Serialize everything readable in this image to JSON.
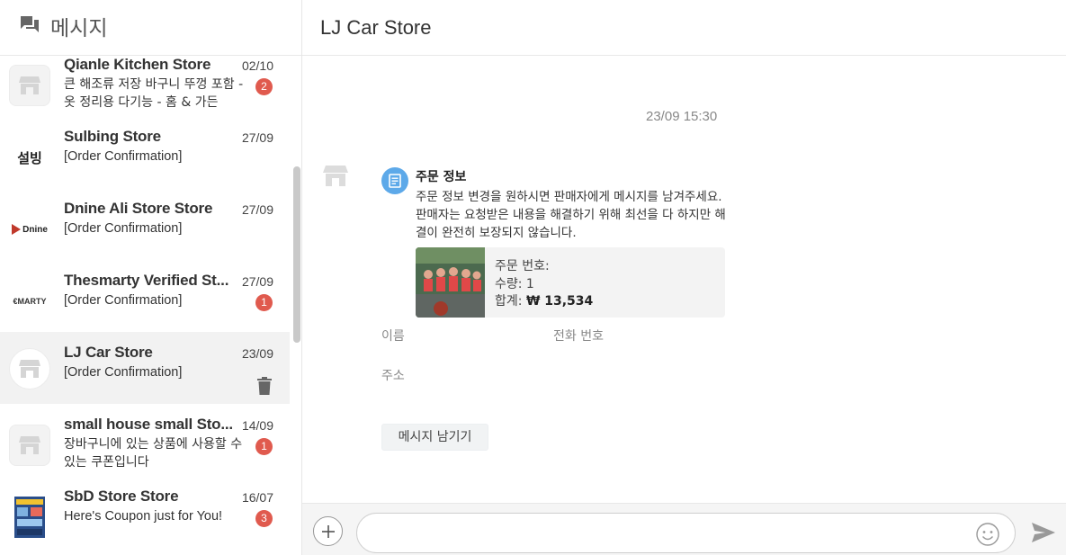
{
  "inbox": {
    "title": "메시지",
    "conversations": [
      {
        "name": "Qianle Kitchen Store",
        "date": "02/10",
        "preview": "큰 해조류 저장 바구니 뚜껑 포함 - 옷 정리용 다기능 - 홈 & 가든",
        "badge": "2"
      },
      {
        "name": "Sulbing Store",
        "date": "27/09",
        "preview": "[Order Confirmation]",
        "logo_text": "설빙"
      },
      {
        "name": "Dnine Ali Store Store",
        "date": "27/09",
        "preview": "[Order Confirmation]",
        "logo_text": "Dnine"
      },
      {
        "name": "Thesmarty Verified St...",
        "date": "27/09",
        "preview": "[Order Confirmation]",
        "badge": "1",
        "logo_text": "€MARTY"
      },
      {
        "name": "LJ Car Store",
        "date": "23/09",
        "preview": "[Order Confirmation]"
      },
      {
        "name": "small house small Sto...",
        "date": "14/09",
        "preview": "장바구니에 있는 상품에 사용할 수 있는 쿠폰입니다",
        "badge": "1"
      },
      {
        "name": "SbD Store Store",
        "date": "16/07",
        "preview": "Here's Coupon just for You!",
        "badge": "3"
      }
    ]
  },
  "chat": {
    "title": "LJ Car Store",
    "timestamp": "23/09 15:30",
    "order_info": {
      "title": "주문 정보",
      "body": "주문 정보 변경을 원하시면 판매자에게 메시지를 남겨주세요. 판매자는 요청받은 내용을 해결하기 위해 최선을 다 하지만 해결이 완전히 보장되지 않습니다.",
      "order_number_label": "주문 번호:",
      "quantity_label": "수량: 1",
      "total_label": "합계:",
      "total_value": "₩ 13,534"
    },
    "fields": {
      "name_label": "이름",
      "phone_label": "전화 번호",
      "address_label": "주소"
    },
    "leave_message_button": "메시지 남기기",
    "composer": {
      "placeholder": ""
    }
  },
  "colors": {
    "badge": "#e05a4e",
    "info_icon": "#5da9e9",
    "selected_row": "#f2f2f2"
  }
}
